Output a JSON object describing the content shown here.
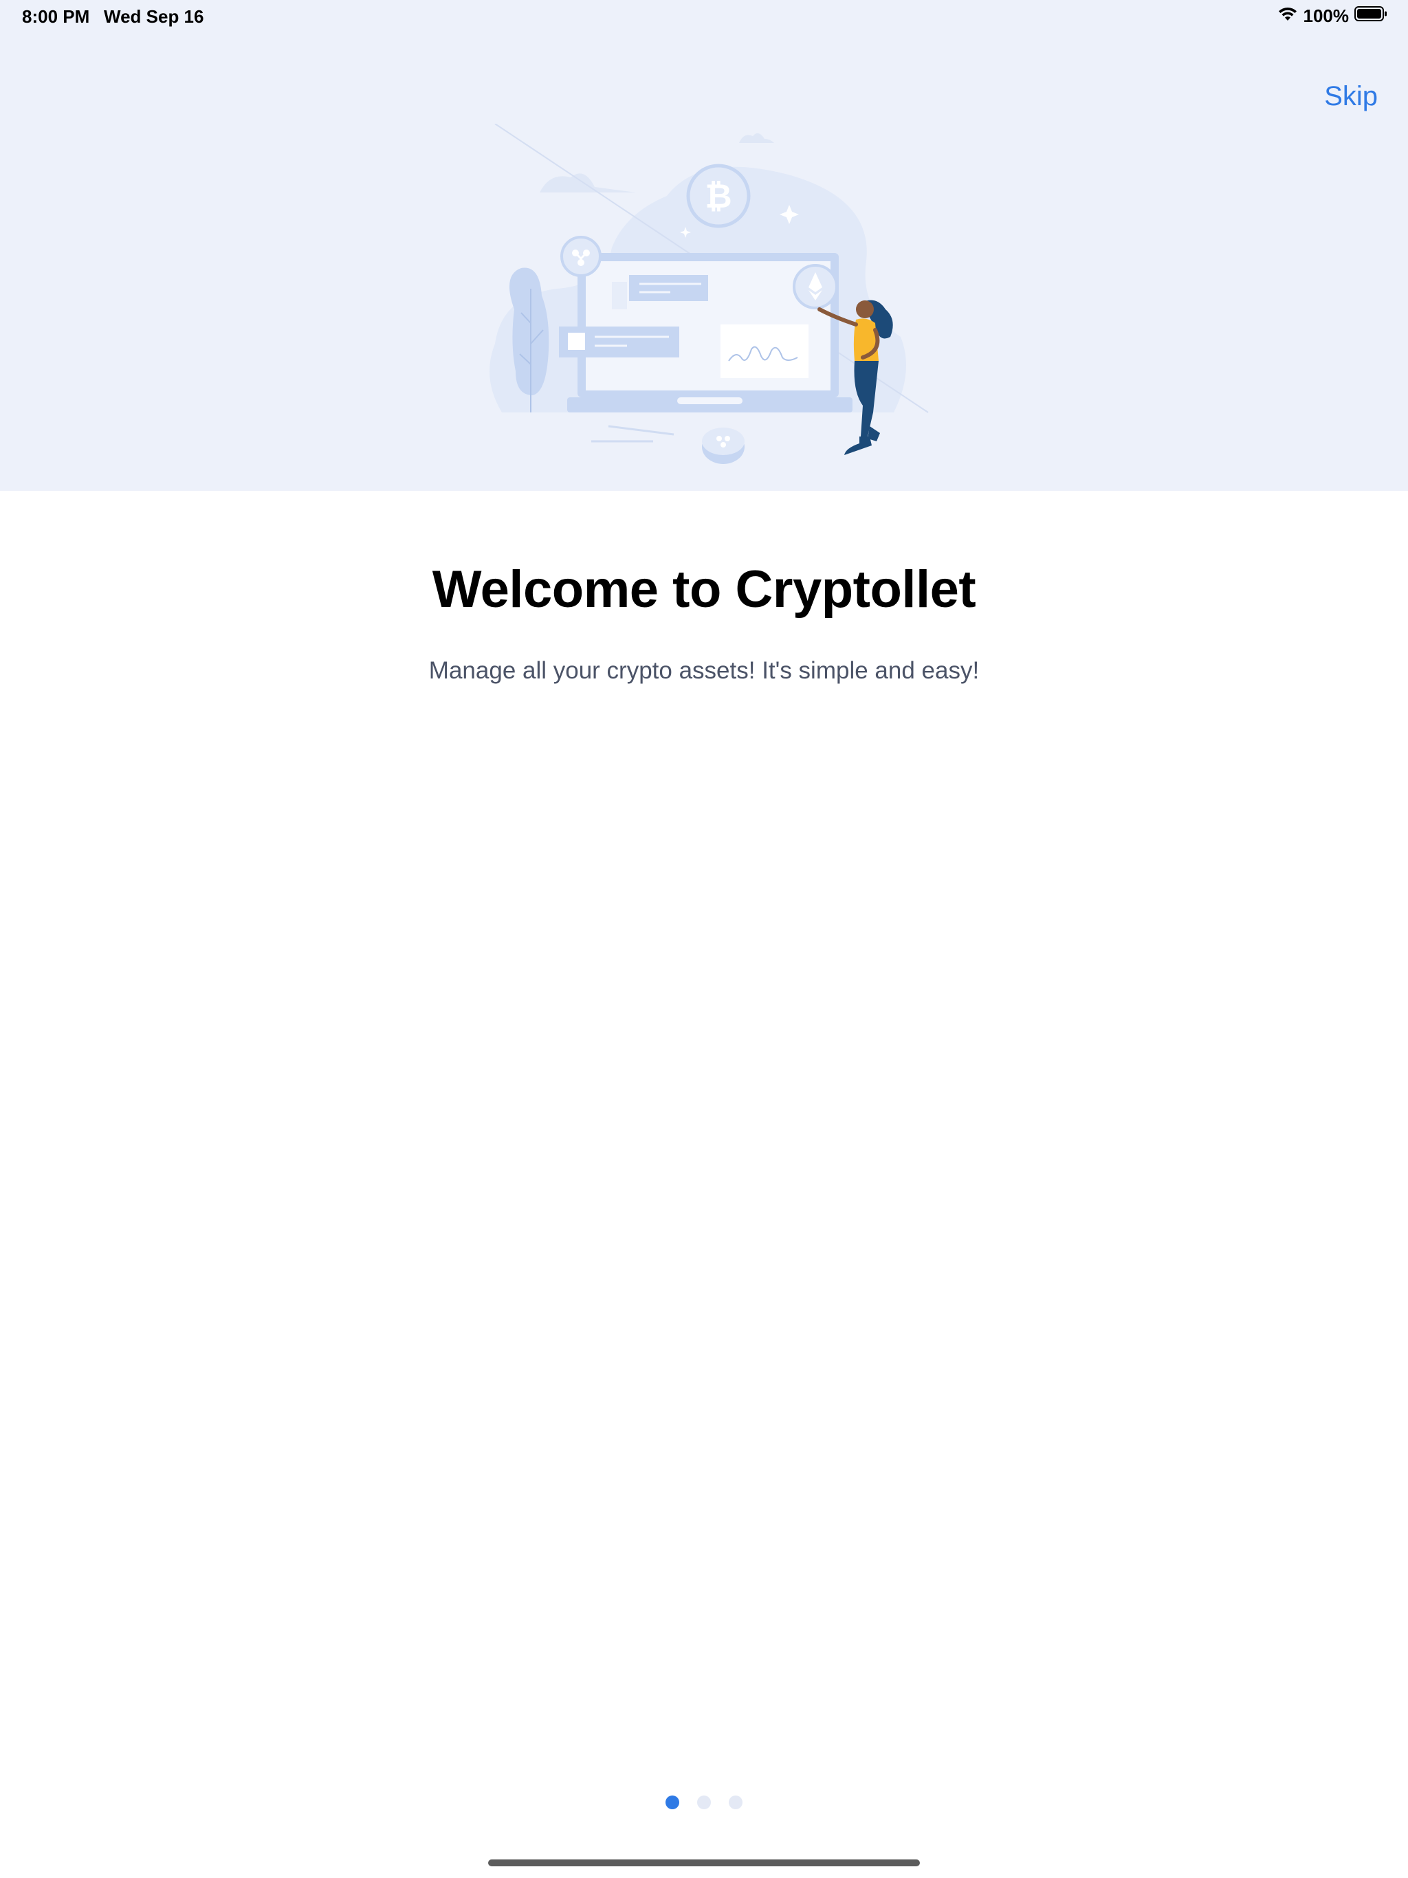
{
  "status_bar": {
    "time": "8:00 PM",
    "date": "Wed Sep 16",
    "battery": "100%"
  },
  "header": {
    "skip_label": "Skip"
  },
  "onboarding": {
    "title": "Welcome to Cryptollet",
    "subtitle": "Manage all your crypto assets! It's simple and easy!",
    "current_page": 1,
    "total_pages": 3
  },
  "colors": {
    "accent": "#2f7ae5",
    "hero_bg": "#edf1fa",
    "illustration_primary": "#c6d6f2",
    "figure_shirt": "#f8b72c",
    "figure_pants": "#1c4a78"
  },
  "icons": [
    "wifi-icon",
    "battery-icon",
    "bitcoin-icon",
    "ethereum-icon",
    "ripple-icon"
  ]
}
